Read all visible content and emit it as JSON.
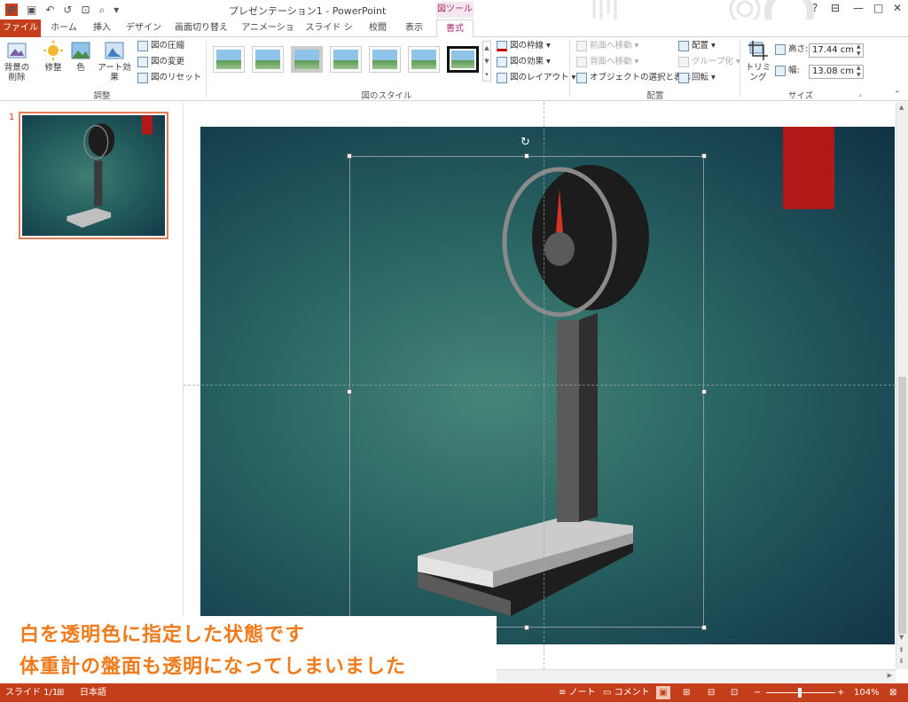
{
  "window": {
    "title": "プレゼンテーション1 - PowerPoint",
    "tool_group": "図ツール",
    "help": "?",
    "minimize": "—",
    "maximize": "□",
    "close": "✕"
  },
  "tabs": [
    "ファイル",
    "ホーム",
    "挿入",
    "デザイン",
    "画面切り替え",
    "アニメーション",
    "スライド ショー",
    "校閲",
    "表示",
    "書式"
  ],
  "ribbon": {
    "adjust": {
      "remove_bg": "背景の\n削除",
      "corrections": "修整",
      "color": "色",
      "artistic": "アート効果",
      "compress": "図の圧縮",
      "change": "図の変更",
      "reset": "図のリセット",
      "label": "調整"
    },
    "styles": {
      "border": "図の枠線",
      "effects": "図の効果",
      "layout": "図のレイアウト",
      "label": "図のスタイル"
    },
    "arrange": {
      "forward": "前面へ移動",
      "backward": "背面へ移動",
      "selection_pane": "オブジェクトの選択と表示",
      "align": "配置",
      "group": "グループ化",
      "rotate": "回転",
      "label": "配置"
    },
    "size": {
      "crop": "トリミング",
      "height_label": "高さ:",
      "height_value": "17.44 cm",
      "width_label": "幅:",
      "width_value": "13.08 cm",
      "label": "サイズ"
    }
  },
  "thumbs": {
    "slide_number": "1"
  },
  "annotation": {
    "line1": "白を透明色に指定した状態です",
    "line2": "体重計の盤面も透明になってしまいました"
  },
  "status": {
    "slide": "スライド 1/1",
    "language": "日本語",
    "notes": "ノート",
    "comments": "コメント",
    "zoom": "104%"
  }
}
